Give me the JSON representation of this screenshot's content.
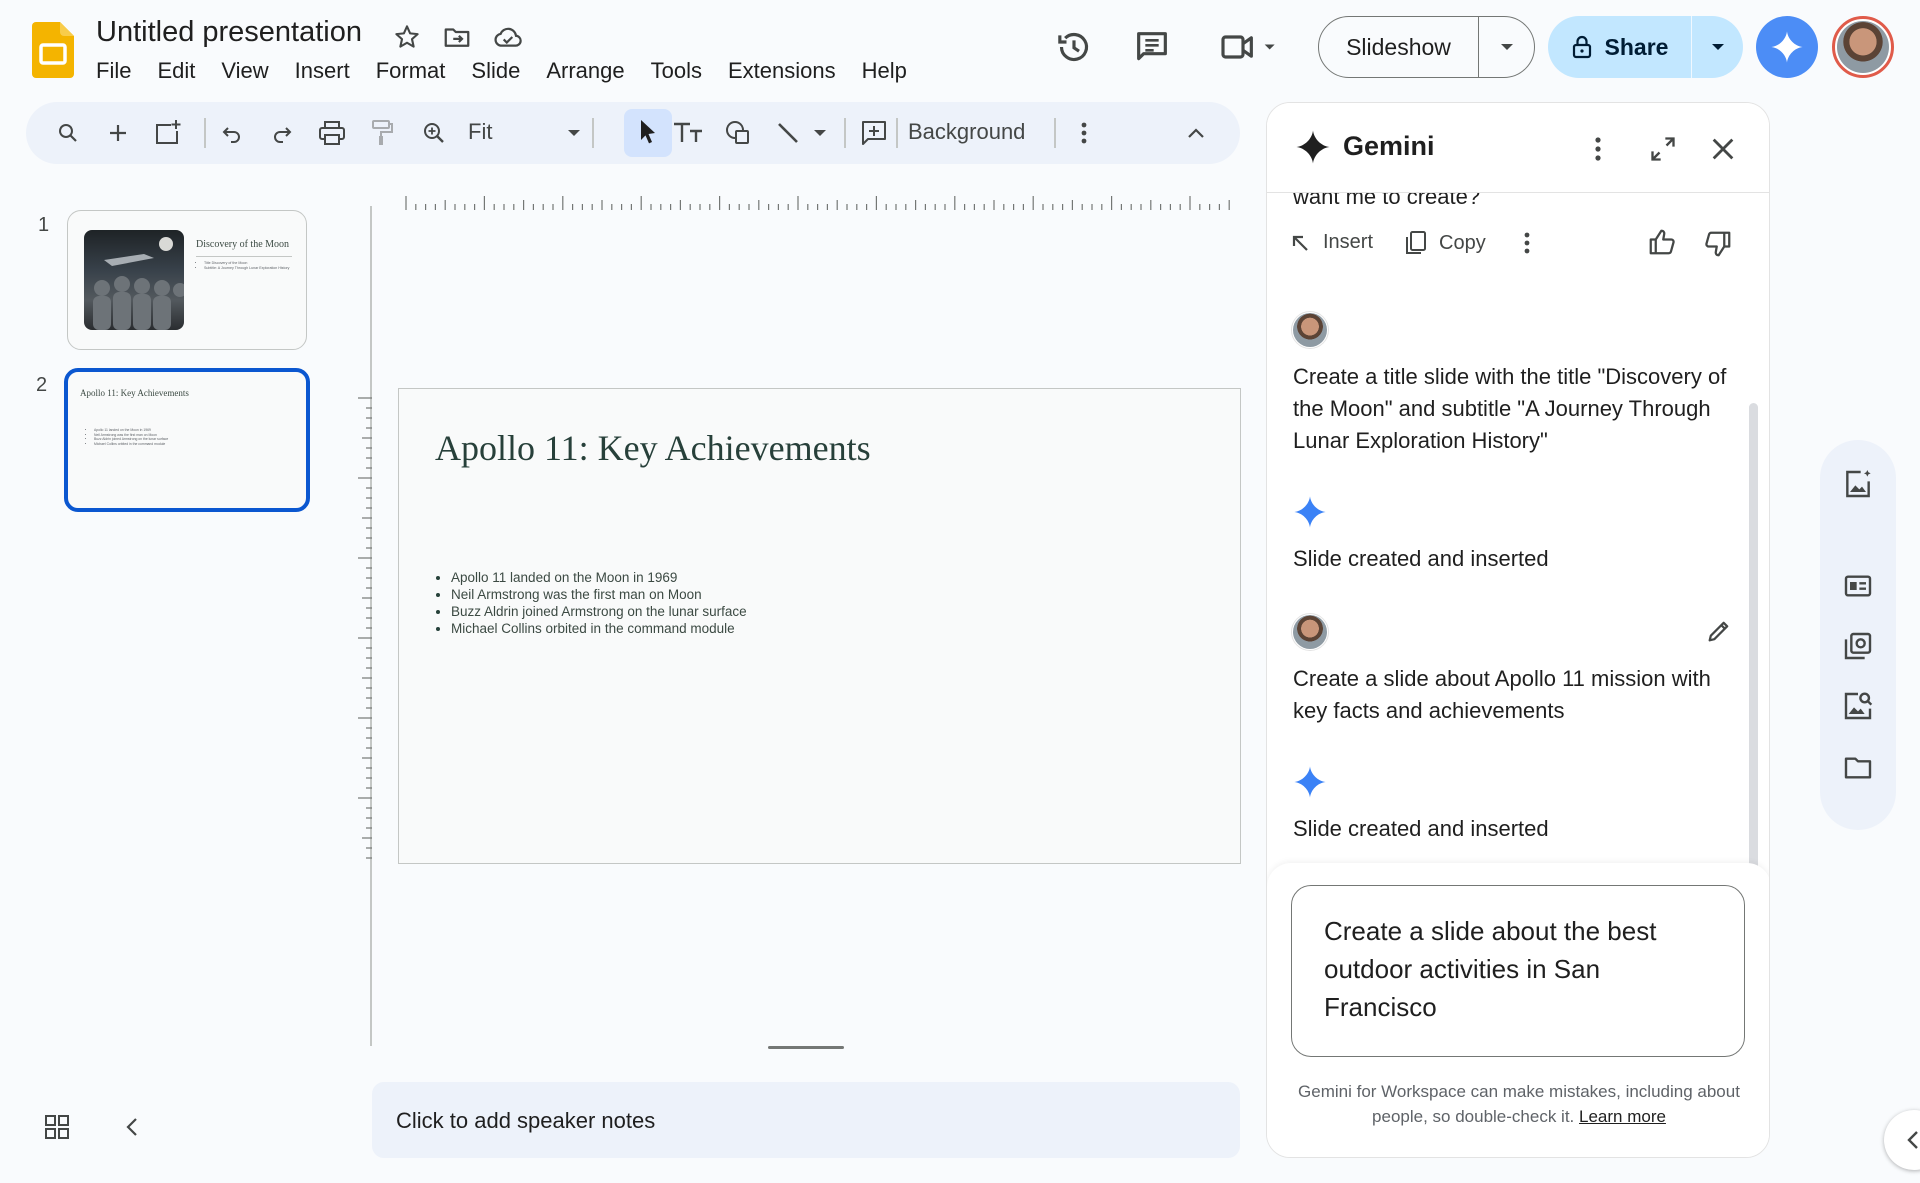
{
  "app": {
    "doc_title": "Untitled presentation",
    "menus": [
      "File",
      "Edit",
      "View",
      "Insert",
      "Format",
      "Slide",
      "Arrange",
      "Tools",
      "Extensions",
      "Help"
    ],
    "slideshow_label": "Slideshow",
    "share_label": "Share",
    "accent_color": "#c2e7ff",
    "brand_color": "#f4b400"
  },
  "toolbar": {
    "zoom_value": "Fit",
    "background_label": "Background"
  },
  "filmstrip": {
    "slides": [
      {
        "number": "1",
        "title": "Discovery of the Moon",
        "bullets": [
          "Title Discovery of the Moon",
          "Subtitle: A Journey Through Lunar Exploration History"
        ]
      },
      {
        "number": "2",
        "title": "Apollo 11: Key Achievements",
        "bullets": [
          "Apollo 11 landed on the Moon in 1969",
          "Neil Armstrong was the first man on Moon",
          "Buzz Aldrin joined Armstrong on the lunar surface",
          "Michael Collins orbited in the command module"
        ]
      }
    ]
  },
  "slide": {
    "title": "Apollo 11: Key Achievements",
    "bullets": [
      "Apollo 11 landed on the Moon in 1969",
      "Neil Armstrong was the first man on Moon",
      "Buzz Aldrin joined Armstrong on the lunar surface",
      "Michael Collins orbited in the command module"
    ]
  },
  "speaker_notes": {
    "placeholder": "Click to add speaker notes"
  },
  "gemini": {
    "title": "Gemini",
    "cut_text": "want me to create?",
    "insert_label": "Insert",
    "copy_label": "Copy",
    "messages": [
      {
        "role": "user",
        "text": "Create a title slide with the title \"Discovery of the Moon\" and subtitle \"A Journey Through Lunar Exploration History\""
      },
      {
        "role": "gemini",
        "text": "Slide created and inserted"
      },
      {
        "role": "user",
        "text": "Create a slide about Apollo 11 mission with key facts and achievements"
      },
      {
        "role": "gemini",
        "text": "Slide created and inserted"
      }
    ],
    "input_value": "Create a slide about the best outdoor activities in San Francisco",
    "disclaimer": "Gemini for Workspace can make mistakes, including about people, so double-check it.",
    "learn_more": "Learn more"
  }
}
